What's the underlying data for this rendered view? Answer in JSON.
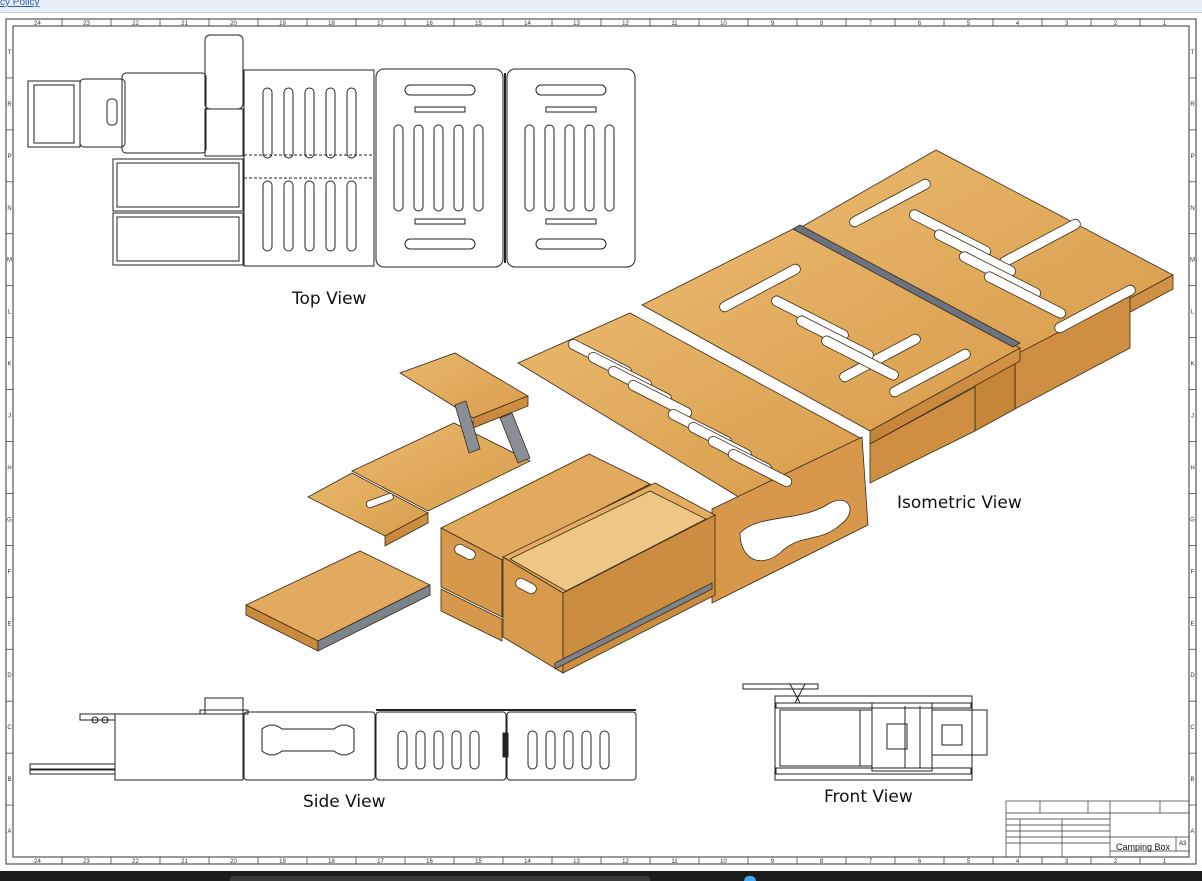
{
  "browser": {
    "link_fragment": "cy Policy"
  },
  "drawing": {
    "title": "Camping Box",
    "size": "A3",
    "views": {
      "top": "Top View",
      "isometric": "Isometric View",
      "side": "Side View",
      "front": "Front View"
    },
    "border_columns": [
      "24",
      "23",
      "22",
      "21",
      "20",
      "19",
      "18",
      "17",
      "16",
      "15",
      "14",
      "13",
      "12",
      "11",
      "10",
      "9",
      "8",
      "7",
      "6",
      "5",
      "4",
      "3",
      "2",
      "1"
    ],
    "border_rows": [
      "T",
      "R",
      "P",
      "N",
      "M",
      "L",
      "K",
      "J",
      "H",
      "G",
      "F",
      "E",
      "D",
      "C",
      "B",
      "A"
    ]
  },
  "colors": {
    "wood": "#e0a95a",
    "wood_dark": "#c98d3e",
    "wood_edge": "#b97b30",
    "line": "#222222",
    "metal": "#8a8f96"
  }
}
